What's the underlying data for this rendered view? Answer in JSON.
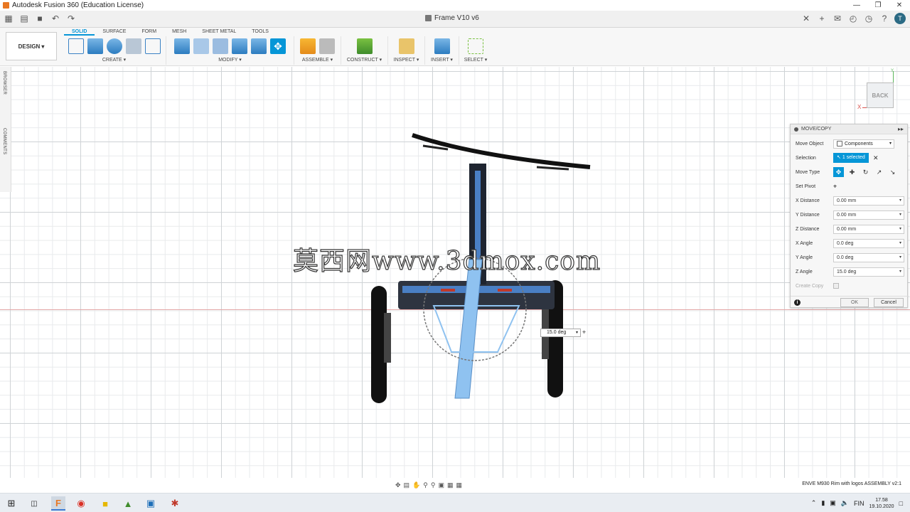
{
  "window": {
    "title": "Autodesk Fusion 360 (Education License)",
    "minimize": "—",
    "restore": "❐",
    "close": "✕"
  },
  "document": {
    "title": "Frame V10 v6"
  },
  "workspace": {
    "label": "DESIGN",
    "caret": "▾"
  },
  "tabs": [
    "SOLID",
    "SURFACE",
    "FORM",
    "MESH",
    "SHEET METAL",
    "TOOLS"
  ],
  "groups": {
    "create": "CREATE",
    "modify": "MODIFY",
    "assemble": "ASSEMBLE",
    "construct": "CONSTRUCT",
    "inspect": "INSPECT",
    "insert": "INSERT",
    "select": "SELECT"
  },
  "side_panel": {
    "browser": "BROWSER",
    "comments": "COMMENTS"
  },
  "view_cube": {
    "face": "BACK",
    "x_axis": "X",
    "y_axis": "Y"
  },
  "watermark": "莫西网www.3dmox.com",
  "dialog": {
    "title": "MOVE/COPY",
    "move_object_label": "Move Object",
    "move_object_value": "Components",
    "selection_label": "Selection",
    "selection_value": "1 selected",
    "selection_clear": "✕",
    "move_type_label": "Move Type",
    "set_pivot_label": "Set Pivot",
    "x_distance_label": "X Distance",
    "x_distance_value": "0.00 mm",
    "y_distance_label": "Y Distance",
    "y_distance_value": "0.00 mm",
    "z_distance_label": "Z Distance",
    "z_distance_value": "0.00 mm",
    "x_angle_label": "X Angle",
    "x_angle_value": "0.0 deg",
    "y_angle_label": "Y Angle",
    "y_angle_value": "0.0 deg",
    "z_angle_label": "Z Angle",
    "z_angle_value": "15.0 deg",
    "create_copy_label": "Create Copy",
    "ok": "OK",
    "cancel": "Cancel"
  },
  "angle_input": {
    "value": "15.0 deg"
  },
  "status": {
    "text": "ENVE M930 Rim with logos ASSEMBLY v2:1"
  },
  "taskbar": {
    "time": "17.58",
    "date": "19.10.2020",
    "lang": "FIN"
  },
  "colors": {
    "accent": "#0696d7",
    "bike_blue": "#4a7fc4",
    "select_blue": "#8fc2f0"
  }
}
